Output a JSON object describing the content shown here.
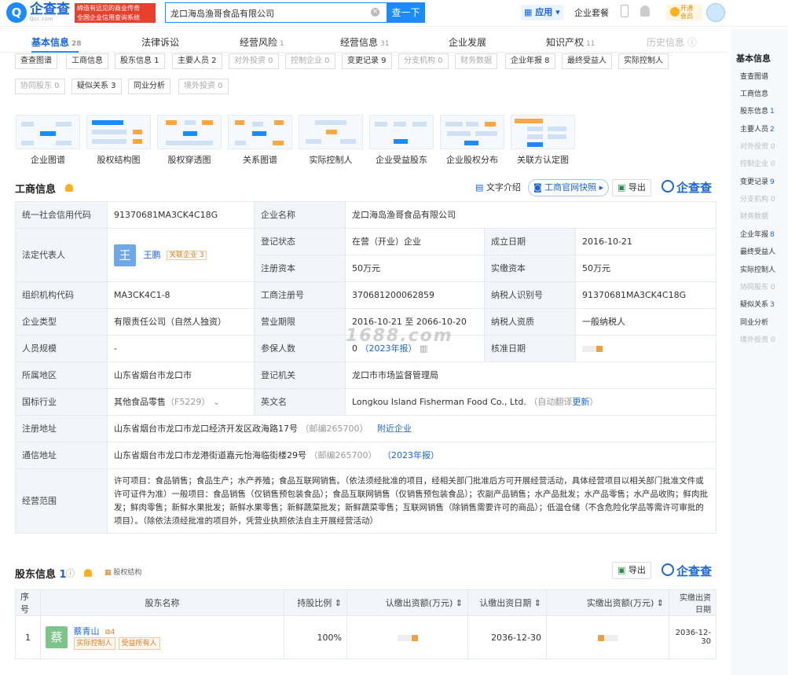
{
  "header": {
    "logo_text": "企查查",
    "logo_sub": "Qcc.com",
    "slogan_line1": "缔造有远见的商业传奇",
    "slogan_line2": "全国企业信用查询系统",
    "search_value": "龙口海岛渔哥食品有限公司",
    "search_button": "查一下",
    "apps_label": "应用",
    "enterprise_label": "企业套餐",
    "vip_line1": "开通",
    "vip_line2": "会员"
  },
  "tabs": [
    {
      "label": "基本信息",
      "count": "28"
    },
    {
      "label": "法律诉讼",
      "count": ""
    },
    {
      "label": "经营风险",
      "count": "1"
    },
    {
      "label": "经营信息",
      "count": "31"
    },
    {
      "label": "企业发展",
      "count": ""
    },
    {
      "label": "知识产权",
      "count": "11"
    },
    {
      "label": "历史信息",
      "count": ""
    }
  ],
  "chips_row1": [
    "查查图谱",
    "工商信息",
    "股东信息 1",
    "主要人员 2",
    "对外投资 0",
    "控制企业 0",
    "变更记录 9",
    "分支机构 0",
    "财务数据",
    "企业年报 8",
    "最终受益人",
    "实际控制人"
  ],
  "chips_row2": [
    "协同股东 0",
    "疑似关系 3",
    "同业分析",
    "境外投资 0"
  ],
  "cards": [
    "企业图谱",
    "股权结构图",
    "股权穿透图",
    "关系图谱",
    "实际控制人",
    "企业受益股东",
    "企业股权分布",
    "关联方认定图"
  ],
  "gs": {
    "title": "工商信息",
    "text_intro": "文字介绍",
    "official_snapshot": "工商官网快照",
    "export": "导出",
    "brand": "企查查",
    "uscc_k": "统一社会信用代码",
    "uscc_v": "91370681MA3CK4C18G",
    "name_k": "企业名称",
    "name_v": "龙口海岛渔哥食品有限公司",
    "legal_k": "法定代表人",
    "legal_avatar": "王",
    "legal_name": "王鹏",
    "legal_rel": "关联企业 3",
    "status_k": "登记状态",
    "status_v": "在营（开业）企业",
    "found_k": "成立日期",
    "found_v": "2016-10-21",
    "reg_cap_k": "注册资本",
    "reg_cap_v": "50万元",
    "paid_cap_k": "实缴资本",
    "paid_cap_v": "50万元",
    "org_k": "组织机构代码",
    "org_v": "MA3CK4C1-8",
    "regno_k": "工商注册号",
    "regno_v": "370681200062859",
    "taxid_k": "纳税人识别号",
    "taxid_v": "91370681MA3CK4C18G",
    "type_k": "企业类型",
    "type_v": "有限责任公司（自然人独资）",
    "term_k": "营业期限",
    "term_v": "2016-10-21 至 2066-10-20",
    "taxq_k": "纳税人资质",
    "taxq_v": "一般纳税人",
    "staff_k": "人员规模",
    "staff_v": "-",
    "insured_k": "参保人数",
    "insured_v": "0",
    "insured_year": "（2023年报）",
    "approve_k": "核准日期",
    "region_k": "所属地区",
    "region_v": "山东省烟台市龙口市",
    "authority_k": "登记机关",
    "authority_v": "龙口市市场监督管理局",
    "industry_k": "国标行业",
    "industry_v": "其他食品零售",
    "industry_code": "（F5229）",
    "en_k": "英文名",
    "en_v": "Longkou Island Fisherman Food Co., Ltd.",
    "en_auto": "（自动翻译",
    "en_update": "更新",
    "reg_addr_k": "注册地址",
    "reg_addr_v": "山东省烟台市龙口市龙口经济开发区政海路17号",
    "reg_addr_zip": "（邮编265700）",
    "nearby": "附近企业",
    "mail_addr_k": "通信地址",
    "mail_addr_v": "山东省烟台市龙口市龙港街道嘉元怡海临街楼29号",
    "mail_addr_zip": "（邮编265700）",
    "mail_year": "（2023年报）",
    "scope_k": "经营范围",
    "scope_v": "许可项目：食品销售；食品生产；水产养殖；食品互联网销售。（依法须经批准的项目，经相关部门批准后方可开展经营活动，具体经营项目以相关部门批准文件或许可证件为准）一般项目：食品销售（仅销售预包装食品）；食品互联网销售（仅销售预包装食品）；农副产品销售；水产品批发；水产品零售；水产品收购；鲜肉批发；鲜肉零售；新鲜水果批发；新鲜水果零售；新鲜蔬菜批发；新鲜蔬菜零售；互联网销售（除销售需要许可的商品）；低温仓储（不含危险化学品等需许可审批的项目）。（除依法须经批准的项目外，凭营业执照依法自主开展经营活动）"
  },
  "watermark": "1688.com",
  "shareholders": {
    "title": "股东信息",
    "count": "1",
    "structure": "股权结构",
    "export": "导出",
    "brand": "企查查",
    "headers": [
      "序号",
      "股东名称",
      "持股比例",
      "认缴出资额(万元)",
      "认缴出资日期",
      "实缴出资额(万元)",
      "实缴出资日期"
    ],
    "rows": [
      {
        "no": "1",
        "avatar": "蔡",
        "name": "蔡青山",
        "rel": "4",
        "tag1": "实际控制人",
        "tag2": "受益所有人",
        "ratio": "100%",
        "sub_date": "2036-12-30",
        "paid_date": "2036-12-30"
      }
    ]
  },
  "sidebar": {
    "title": "基本信息",
    "items": [
      {
        "label": "查查图谱",
        "n": "",
        "dis": false
      },
      {
        "label": "工商信息",
        "n": "",
        "dis": false
      },
      {
        "label": "股东信息",
        "n": "1",
        "dis": false
      },
      {
        "label": "主要人员",
        "n": "2",
        "dis": false
      },
      {
        "label": "对外投资 0",
        "n": "",
        "dis": true
      },
      {
        "label": "控制企业 0",
        "n": "",
        "dis": true
      },
      {
        "label": "变更记录",
        "n": "9",
        "dis": false
      },
      {
        "label": "分支机构 0",
        "n": "",
        "dis": true
      },
      {
        "label": "财务数据",
        "n": "",
        "dis": true
      },
      {
        "label": "企业年报",
        "n": "8",
        "dis": false
      },
      {
        "label": "最终受益人",
        "n": "",
        "dis": false
      },
      {
        "label": "实际控制人",
        "n": "",
        "dis": false
      },
      {
        "label": "协同股东 0",
        "n": "",
        "dis": true
      },
      {
        "label": "疑似关系",
        "n": "3",
        "dis": false
      },
      {
        "label": "同业分析",
        "n": "",
        "dis": false
      },
      {
        "label": "境外投资 0",
        "n": "",
        "dis": true
      }
    ]
  }
}
